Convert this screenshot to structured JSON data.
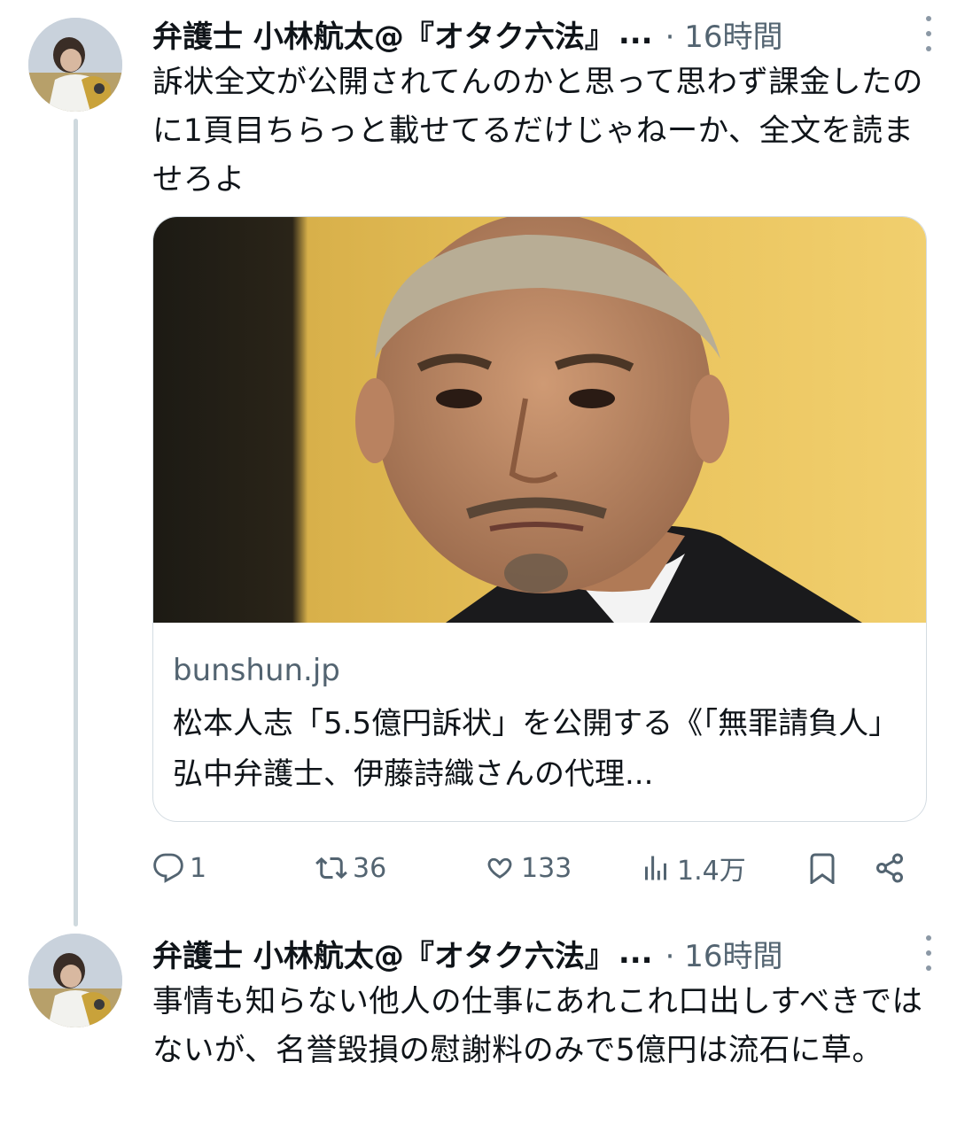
{
  "tweets": [
    {
      "author": "弁護士 小林航太@『オタク六法』",
      "ellipsis": "...",
      "time": "· 16時間",
      "body": "訴状全文が公開されてんのかと思って思わず課金したのに1頁目ちらっと載せてるだけじゃねーか、全文を読ませろよ",
      "card": {
        "domain": "bunshun.jp",
        "title": "松本人志「5.5億円訴状」を公開する《「無罪請負人」弘中弁護士、伊藤詩織さんの代理..."
      },
      "actions": {
        "reply_count": "1",
        "retweet_count": "36",
        "like_count": "133",
        "views_count": "1.4万"
      }
    },
    {
      "author": "弁護士 小林航太@『オタク六法』",
      "ellipsis": "...",
      "time": "· 16時間",
      "body": "事情も知らない他人の仕事にあれこれ口出しすべきではないが、名誉毀損の慰謝料のみで5億円は流石に草。"
    }
  ],
  "icons": {
    "reply": "reply-icon",
    "retweet": "retweet-icon",
    "like": "heart-icon",
    "views": "views-icon",
    "bookmark": "bookmark-icon",
    "share": "share-icon",
    "more": "more-vertical-icon"
  },
  "colors": {
    "text": "#0f1419",
    "secondary": "#536471",
    "border": "#d4dce2",
    "thread_line": "#cfd9de"
  }
}
